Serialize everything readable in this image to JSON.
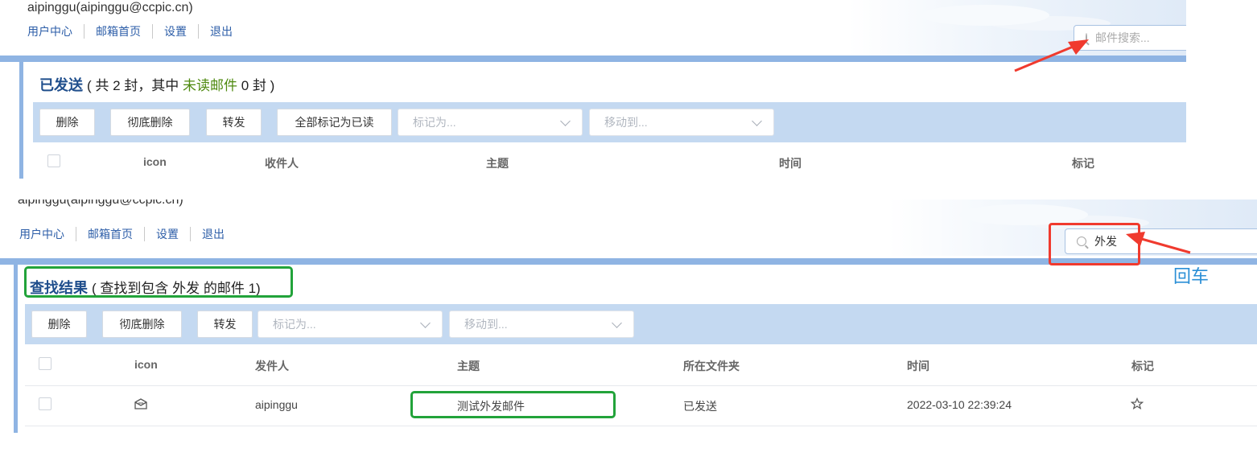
{
  "top": {
    "user": "aipinggu(aipinggu@ccpic.cn)",
    "nav": [
      "用户中心",
      "邮箱首页",
      "设置",
      "退出"
    ],
    "search_placeholder": "邮件搜索...",
    "folder_title": "已发送",
    "count_prefix": "( 共 2 封，其中 ",
    "unread_label": "未读邮件",
    "count_suffix": " 0 封 )",
    "buttons": [
      "删除",
      "彻底删除",
      "转发",
      "全部标记为已读"
    ],
    "mark_as": "标记为...",
    "move_to": "移动到...",
    "columns": [
      "icon",
      "收件人",
      "主题",
      "时间",
      "标记"
    ]
  },
  "bottom": {
    "user": "aipinggu(aipinggu@ccpic.cn)",
    "nav": [
      "用户中心",
      "邮箱首页",
      "设置",
      "退出"
    ],
    "search_value": "外发",
    "result_title": "查找结果",
    "result_desc": "( 查找到包含 外发 的邮件 1)",
    "buttons": [
      "删除",
      "彻底删除",
      "转发"
    ],
    "mark_as": "标记为...",
    "move_to": "移动到...",
    "columns": [
      "icon",
      "发件人",
      "主题",
      "所在文件夹",
      "时间",
      "标记"
    ],
    "rows": [
      {
        "sender": "aipinggu",
        "subject": "测试外发邮件",
        "folder": "已发送",
        "time": "2022-03-10 22:39:24"
      }
    ]
  },
  "annotation": {
    "enter_label": "回车"
  },
  "colors": {
    "nav_link": "#2d5ea8",
    "toolbar_bg": "#c4d9f1",
    "accent_bar": "#8fb4e3",
    "title": "#1f4e8c",
    "unread": "#4f8a10",
    "highlight_red": "#f03a2e",
    "highlight_green": "#22a33a"
  },
  "icons": {
    "search": "search-icon",
    "mail": "mail-open-icon",
    "star": "star-outline-icon",
    "dropdown": "chevron-down-icon"
  }
}
